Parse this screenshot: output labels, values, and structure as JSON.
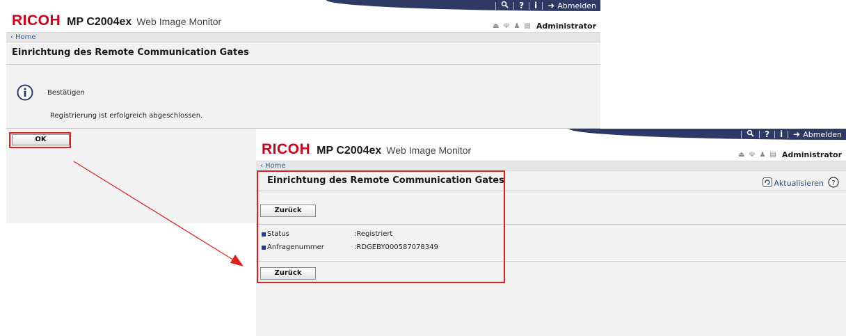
{
  "header": {
    "brand": "RICOH",
    "model": "MP C2004ex",
    "app_name": "Web Image Monitor",
    "top_icons": {
      "search": "search-icon",
      "help": "help-icon",
      "info": "info-icon",
      "logout": "logout-icon"
    },
    "logout_label": "Abmelden",
    "user_label": "Administrator",
    "menu_icons": [
      "eject-icon",
      "network-icon",
      "user-icon",
      "list-icon"
    ]
  },
  "breadcrumb": {
    "home_label": "Home"
  },
  "confirm_screen": {
    "title": "Einrichtung des Remote Communication Gates",
    "confirm_label": "Bestätigen",
    "message": "Registrierung ist erfolgreich abgeschlossen.",
    "ok_label": "OK"
  },
  "status_screen": {
    "title": "Einrichtung des Remote Communication Gates",
    "refresh_label": "Aktualisieren",
    "back_label": "Zurück",
    "fields": [
      {
        "label": "Status",
        "value": ":Registriert"
      },
      {
        "label": "Anfragenummer",
        "value": ":RDGEBY000587078349"
      }
    ]
  },
  "colors": {
    "brand_red": "#d0001c",
    "header_band": "#2e3a63",
    "highlight": "#e02020",
    "link": "#3a5a90"
  }
}
